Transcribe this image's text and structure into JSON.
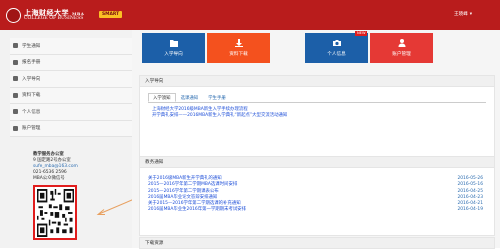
{
  "header": {
    "logo_cn": "上海财经大学",
    "logo_tag": "MBA",
    "logo_en": "COLLEGE OF BUSINESS",
    "smart": "SMART",
    "user": "王晓峰",
    "caret": "▾"
  },
  "colors": {
    "brand": "#b91c1c",
    "tile_blue": "#1c5fa8",
    "tile_orange": "#f4511e",
    "tile_red": "#e53935",
    "qr_border": "#e11d1d"
  },
  "sidebar": {
    "items": [
      {
        "label": "学生通知",
        "icon": "bell-icon"
      },
      {
        "label": "报名手册",
        "icon": "book-icon"
      },
      {
        "label": "入学导向",
        "icon": "compass-icon"
      },
      {
        "label": "资料下载",
        "icon": "download-icon"
      },
      {
        "label": "个人信息",
        "icon": "person-icon"
      },
      {
        "label": "账户管理",
        "icon": "account-icon"
      }
    ]
  },
  "contact": {
    "title": "教学服务办公室",
    "address": "9 国定路2号办公室",
    "email": "sufe_mba@163.com",
    "phone": "021-6536 2596",
    "wechat": "MBA公众微信号"
  },
  "tiles": [
    {
      "label": "入学导向",
      "icon": "folder-icon"
    },
    {
      "label": "资料下载",
      "icon": "download-icon"
    },
    {
      "label": "个人信息",
      "icon": "camera-icon",
      "badge": "NEW"
    },
    {
      "label": "账户管理",
      "icon": "user-icon"
    }
  ],
  "panels": {
    "guide": {
      "title": "入学导向",
      "tabs": [
        "入学须知",
        "选课通知",
        "学生手册"
      ],
      "links": [
        "上海财经大学2016级MBA新生入学手续办理流程",
        "开学典礼安排——2016MBA新生入学典礼“新起点”大型交流活动通知"
      ]
    },
    "notice": {
      "title": "教务通知",
      "items": [
        {
          "title": "关于2016级MBA新生开学典礼的通知",
          "date": "2016-05-26"
        },
        {
          "title": "2015—2016学年第二学期MBA选课时间安排",
          "date": "2016-05-16"
        },
        {
          "title": "2015—2016学年第二学期课表公布",
          "date": "2016-04-25"
        },
        {
          "title": "2016届MBA毕业论文答辩安排通知",
          "date": "2016-04-23"
        },
        {
          "title": "关于2015—2016学年第二学期选课的补充通知",
          "date": "2016-04-21"
        },
        {
          "title": "2016届MBA毕业生2016年第一学期期末考试安排",
          "date": "2016-04-19"
        }
      ]
    },
    "downloads": {
      "title": "下载资源"
    }
  }
}
